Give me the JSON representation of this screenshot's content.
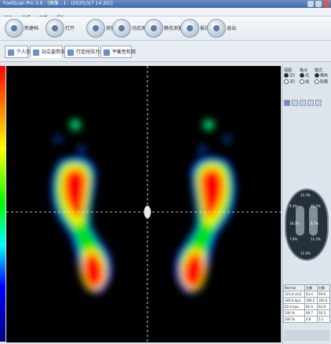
{
  "window": {
    "title": "FootScan Pro 3.0 - [图像 - 1 - (2025/3/7 14:20)]"
  },
  "menu": [
    "文件",
    "编辑",
    "查看",
    "帮助"
  ],
  "toolbar": {
    "buttons": [
      {
        "label": "新建档"
      },
      {
        "label": "打开"
      },
      {
        "label": "测量"
      },
      {
        "label": "动态测量"
      },
      {
        "label": "静态测量"
      },
      {
        "label": "报告"
      },
      {
        "label": "退出"
      }
    ]
  },
  "tabs": [
    {
      "label": "个人信息"
    },
    {
      "label": "站立姿势压力分布"
    },
    {
      "label": "行走时压力分布"
    },
    {
      "label": "平衡性检测"
    }
  ],
  "panel": {
    "view_group": {
      "title": "视图",
      "options": [
        "2D",
        "3D"
      ],
      "selected": "2D"
    },
    "cell_group": {
      "title": "格点",
      "options": [
        "点",
        "线"
      ],
      "selected": "点"
    },
    "mode_group": {
      "title": "模式",
      "options": [
        "填充",
        "轮廓"
      ],
      "selected": "填充"
    },
    "mini_percentages": [
      "12.3%",
      "9.1%",
      "21.5%",
      "18.2%",
      "8.7%",
      "7.6%",
      "11.2%",
      "11.4%"
    ],
    "table": [
      [
        "Normal",
        "左脚",
        "右脚"
      ],
      [
        "123.0 cm2",
        "63.4",
        "59.6"
      ],
      [
        "185.6 kpa",
        "180.2",
        "185.6"
      ],
      [
        "62.4 kpa",
        "61.9",
        "62.8"
      ],
      [
        "100 %",
        "49.7",
        "50.3"
      ],
      [
        "200 %",
        "4.8",
        "5.1"
      ]
    ]
  },
  "colors": {
    "scale_top": "#ff0000",
    "scale_bottom": "#000080",
    "canvas_bg": "#000000"
  }
}
